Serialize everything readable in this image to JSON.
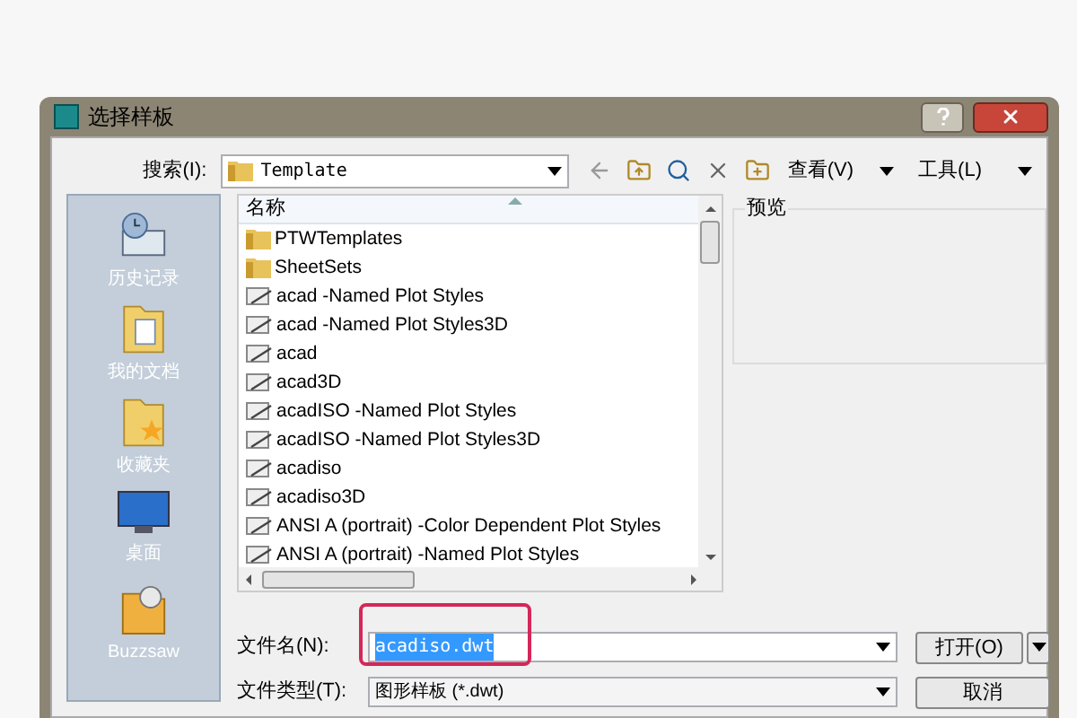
{
  "window": {
    "title": "选择样板"
  },
  "toolbar": {
    "look_in_label": "搜索(I):",
    "look_in_value": "Template",
    "view_menu": "查看(V)",
    "tools_menu": "工具(L)"
  },
  "places": [
    {
      "kind": "history",
      "label": "历史记录"
    },
    {
      "kind": "documents",
      "label": "我的文档"
    },
    {
      "kind": "favorites",
      "label": "收藏夹"
    },
    {
      "kind": "desktop",
      "label": "桌面"
    },
    {
      "kind": "buzzsaw",
      "label": "Buzzsaw"
    }
  ],
  "file_list": {
    "column": "名称",
    "items": [
      {
        "kind": "folder",
        "name": "PTWTemplates"
      },
      {
        "kind": "folder",
        "name": "SheetSets"
      },
      {
        "kind": "template",
        "name": "acad -Named Plot Styles"
      },
      {
        "kind": "template",
        "name": "acad -Named Plot Styles3D"
      },
      {
        "kind": "template",
        "name": "acad"
      },
      {
        "kind": "template",
        "name": "acad3D"
      },
      {
        "kind": "template",
        "name": "acadISO -Named Plot Styles"
      },
      {
        "kind": "template",
        "name": "acadISO -Named Plot Styles3D"
      },
      {
        "kind": "template",
        "name": "acadiso"
      },
      {
        "kind": "template",
        "name": "acadiso3D"
      },
      {
        "kind": "template",
        "name": "ANSI A (portrait) -Color Dependent Plot Styles"
      },
      {
        "kind": "template",
        "name": "ANSI A (portrait) -Named Plot Styles"
      }
    ]
  },
  "preview": {
    "label": "预览"
  },
  "file_name": {
    "label": "文件名(N):",
    "value": "acadiso.dwt",
    "text_selected": true,
    "highlighted": true
  },
  "file_type": {
    "label": "文件类型(T):",
    "value": "图形样板 (*.dwt)"
  },
  "buttons": {
    "open": "打开(O)",
    "cancel": "取消"
  }
}
